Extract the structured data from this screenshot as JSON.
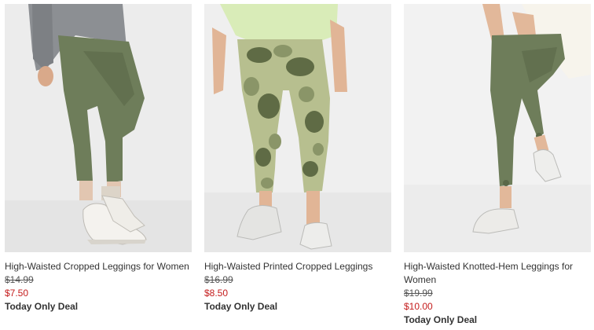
{
  "products": [
    {
      "name": "High-Waisted Cropped Leggings for Women",
      "original_price": "$14.99",
      "sale_price": "$7.50",
      "badge": "Today Only Deal",
      "image_icon": "olive-cropped-leggings-photo"
    },
    {
      "name": "High-Waisted Printed Cropped Leggings",
      "original_price": "$16.99",
      "sale_price": "$8.50",
      "badge": "Today Only Deal",
      "image_icon": "camo-cropped-leggings-photo"
    },
    {
      "name": "High-Waisted Knotted-Hem Leggings for Women",
      "original_price": "$19.99",
      "sale_price": "$10.00",
      "badge": "Today Only Deal",
      "image_icon": "olive-knotted-hem-leggings-photo"
    }
  ],
  "colors": {
    "sale_price": "#c41c1c",
    "legging_olive": "#6e7d5a",
    "camo_light": "#b7bf8f",
    "camo_dark": "#5f6b45",
    "photo_bg": "#ededed"
  }
}
